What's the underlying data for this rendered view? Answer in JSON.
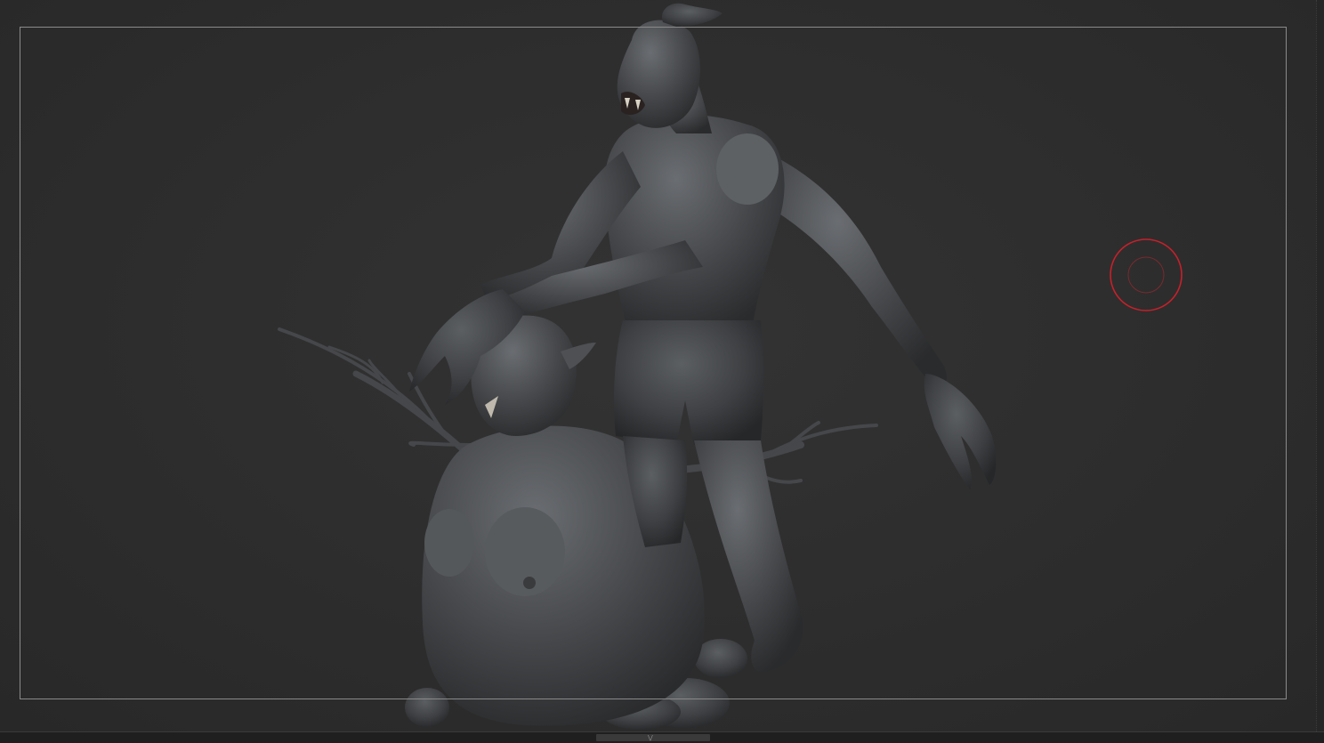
{
  "viewport": {
    "background_color": "#2d2d2d",
    "frame_color": "#8a8a8a",
    "clay_color": "#4a4c4f"
  },
  "brush_cursor": {
    "icon": "brush-cursor-icon",
    "color": "#c8202a"
  },
  "bottom_bar": {
    "handle_icon": "expand-handle-icon",
    "handle_glyph": "⋁"
  }
}
